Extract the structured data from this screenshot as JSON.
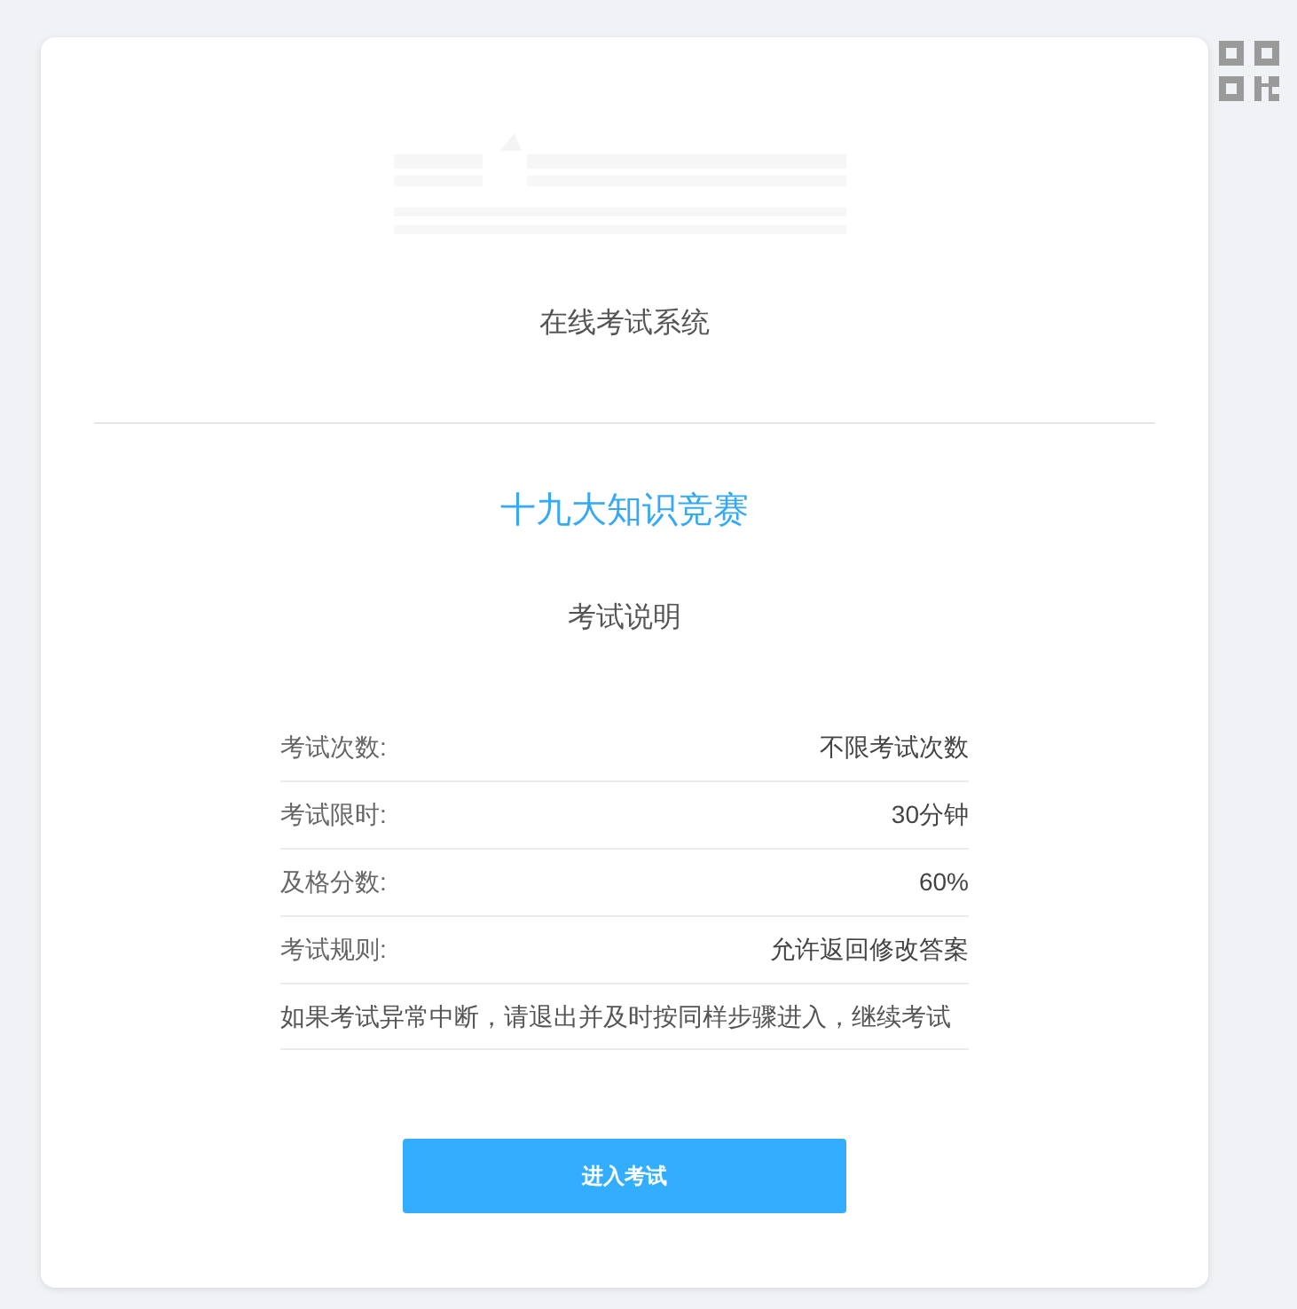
{
  "header": {
    "subtitle": "在线考试系统"
  },
  "exam": {
    "title": "十九大知识竞赛",
    "section_title": "考试说明"
  },
  "rules": [
    {
      "kind": "pair",
      "label": "考试次数:",
      "value": "不限考试次数"
    },
    {
      "kind": "pair",
      "label": "考试限时:",
      "value": "30分钟"
    },
    {
      "kind": "pair",
      "label": "及格分数:",
      "value": "60%"
    },
    {
      "kind": "pair",
      "label": "考试规则:",
      "value": "允许返回修改答案"
    },
    {
      "kind": "note",
      "text": "如果考试异常中断，请退出并及时按同样步骤进入，继续考试"
    }
  ],
  "start_button": "进入考试"
}
